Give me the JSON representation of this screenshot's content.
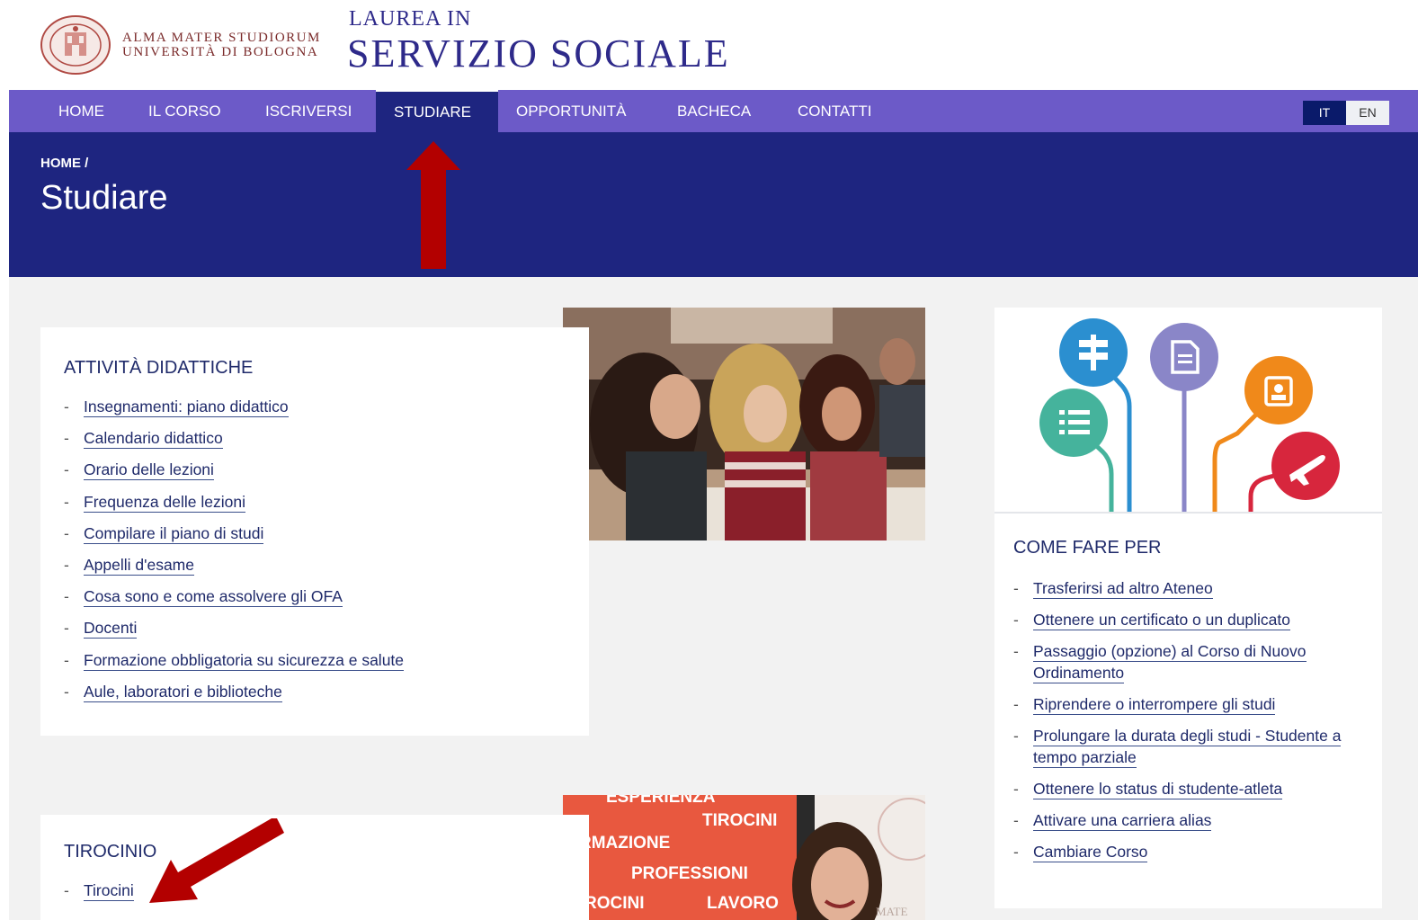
{
  "header": {
    "university_line1": "ALMA MATER STUDIORUM",
    "university_line2": "UNIVERSITÀ DI BOLOGNA",
    "course_prefix": "LAUREA IN",
    "course_name": "SERVIZIO SOCIALE",
    "seal_text": "ALMA MATER STUDIORUM · A.D. 1088"
  },
  "nav": {
    "items": [
      {
        "label": "HOME"
      },
      {
        "label": "IL CORSO"
      },
      {
        "label": "ISCRIVERSI"
      },
      {
        "label": "STUDIARE",
        "active": true
      },
      {
        "label": "OPPORTUNITÀ"
      },
      {
        "label": "BACHECA"
      },
      {
        "label": "CONTATTI"
      }
    ],
    "languages": [
      {
        "code": "IT",
        "active": true
      },
      {
        "code": "EN",
        "active": false
      }
    ]
  },
  "hero": {
    "breadcrumb": "HOME /",
    "title": "Studiare"
  },
  "attivita": {
    "title": "ATTIVITÀ DIDATTICHE",
    "links": [
      "Insegnamenti: piano didattico",
      "Calendario didattico",
      "Orario delle lezioni",
      "Frequenza delle lezioni",
      "Compilare il piano di studi",
      "Appelli d'esame",
      "Cosa sono e come assolvere gli OFA",
      "Docenti",
      "Formazione obbligatoria su sicurezza e salute",
      "Aule, laboratori e biblioteche"
    ]
  },
  "tirocinio": {
    "title": "TIROCINIO",
    "links": [
      "Tirocini"
    ]
  },
  "tirocinio_photo": {
    "words": [
      "ESPERIENZA",
      "TIROCINI",
      "RMAZIONE",
      "PROFESSIONI",
      "ROCINI",
      "LAVORO",
      "MATE"
    ]
  },
  "come_fare": {
    "title": "COME FARE PER",
    "links": [
      "Trasferirsi ad altro Ateneo",
      "Ottenere un certificato o un duplicato",
      "Passaggio (opzione) al Corso di Nuovo Ordinamento",
      "Riprendere o interrompere gli studi",
      "Prolungare la durata degli studi - Studente a tempo parziale",
      "Ottenere lo status di studente-atleta",
      "Attivare una carriera alias",
      "Cambiare Corso"
    ],
    "icons": [
      "signpost-icon",
      "document-icon",
      "list-icon",
      "badge-icon",
      "airplane-icon"
    ]
  },
  "colors": {
    "nav_bg": "#6c5ac8",
    "hero_bg": "#1e2580",
    "content_bg": "#f2f2f2",
    "link": "#1f2a6a",
    "arrow": "#b30000"
  }
}
